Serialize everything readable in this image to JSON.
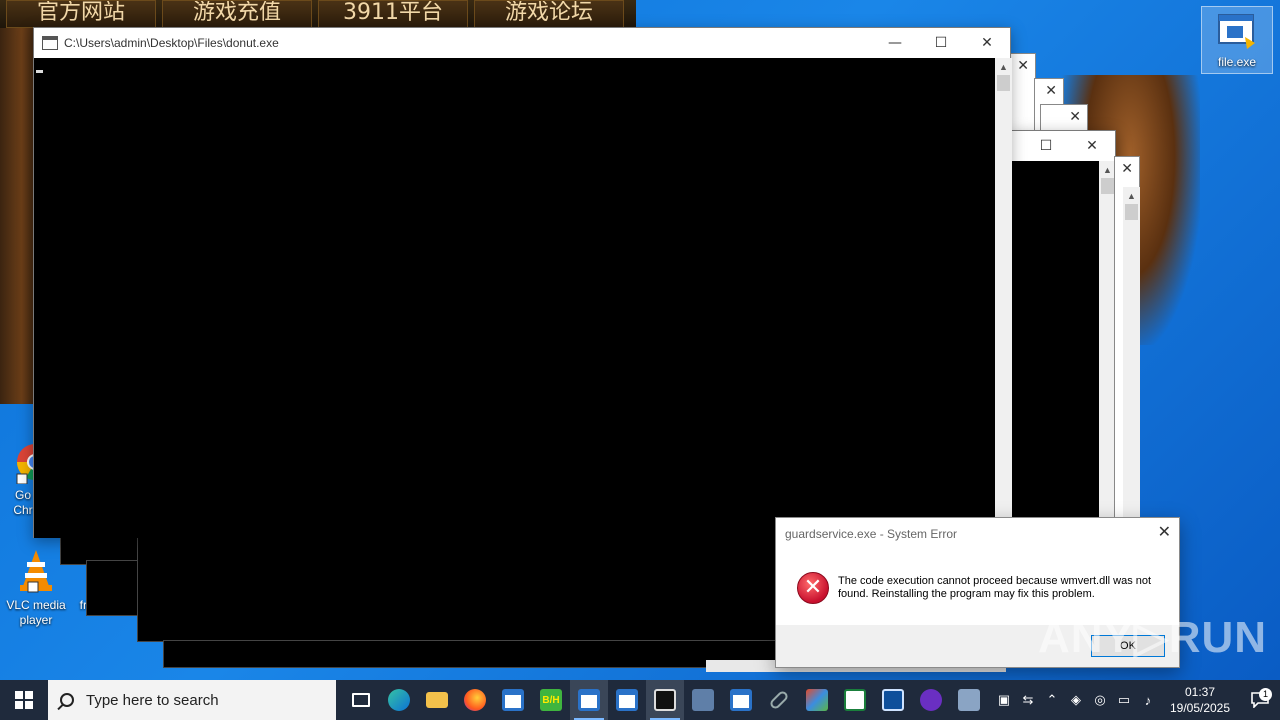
{
  "banner": {
    "tabs": [
      "官方网站",
      "游戏充值",
      "3911平台",
      "游戏论坛"
    ]
  },
  "desktop_icons": [
    {
      "label": "file.exe"
    },
    {
      "label": "Go Chr"
    },
    {
      "label": "VLC media player"
    },
    {
      "label": "frame"
    }
  ],
  "console_window": {
    "title": "C:\\Users\\admin\\Desktop\\Files\\donut.exe",
    "minimize": "—",
    "maximize": "☐",
    "close": "✕"
  },
  "background_window": {
    "maximize": "☐",
    "close": "✕"
  },
  "error_dialog": {
    "title": "guardservice.exe - System Error",
    "close": "✕",
    "icon": "error-icon",
    "icon_glyph": "✕",
    "message": "The code execution cannot proceed because wmvert.dll was not found. Reinstalling the program may fix this problem.",
    "ok_label": "OK"
  },
  "watermark": "ANY▷RUN",
  "taskbar": {
    "search_placeholder": "Type here to search",
    "time": "01:37",
    "date": "19/05/2025",
    "notifications": "1"
  },
  "colors": {
    "desktop": "#0b6fd6",
    "taskbar": "#1f2a3c",
    "error_red": "#c8102e",
    "accent": "#0078d7"
  }
}
